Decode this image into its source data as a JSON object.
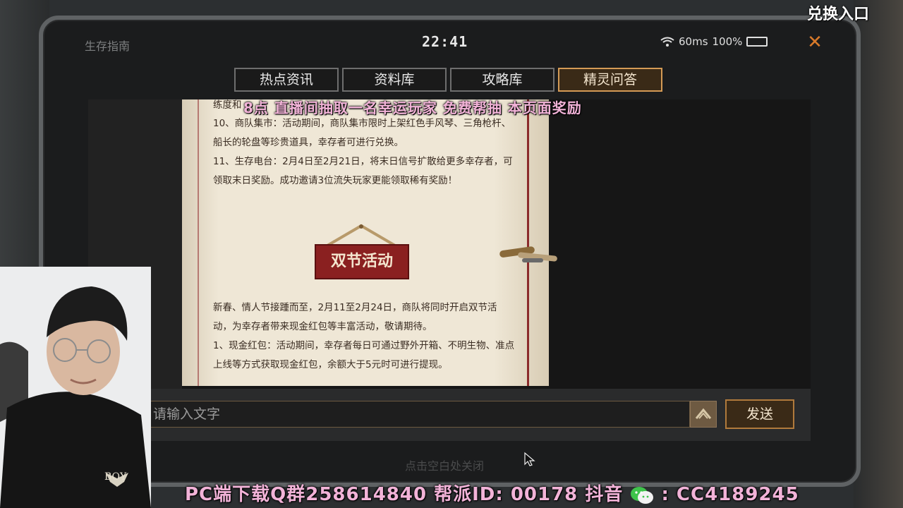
{
  "window": {
    "title": "生存指南",
    "time": "22:41",
    "ping": "60ms",
    "battery": "100%",
    "battery_level": 1.0
  },
  "tabs": [
    {
      "label": "热点资讯",
      "active": false
    },
    {
      "label": "资料库",
      "active": false
    },
    {
      "label": "攻略库",
      "active": false
    },
    {
      "label": "精灵问答",
      "active": true
    }
  ],
  "article": {
    "line_partial": "练度和",
    "item10": "10、商队集市：活动期间，商队集市限时上架红色手风琴、三角枪杆、船长的轮盘等珍贵道具，幸存者可进行兑换。",
    "item11": "11、生存电台：2月4日至2月21日，将末日信号扩散给更多幸存者，可领取末日奖励。成功邀请3位流失玩家更能领取稀有奖励！",
    "banner": "双节活动",
    "intro": "新春、情人节接踵而至，2月11至2月24日，商队将同时开启双节活动，为幸存者带来现金红包等丰富活动，敬请期待。",
    "item1": "1、现金红包：活动期间，幸存者每日可通过野外开箱、不明生物、准点上线等方式获取现金红包，余额大于5元时可进行提现。"
  },
  "input": {
    "placeholder": "请输入文字",
    "send_label": "发送"
  },
  "hint": "点击空白处关闭",
  "overlays": {
    "top": "8点 直播间抽取一名幸运玩家  免费帮抽 本页面奖励",
    "corner": "兑换入口",
    "bottom_left": "PC端下载Q群258614840  帮派ID: 00178  抖音",
    "bottom_right": ": CC4189245"
  },
  "webcam": {
    "logo_text": "BOY"
  },
  "colors": {
    "accent": "#d49a55",
    "close": "#d97a2a",
    "overlay_pink": "#f2b3d8",
    "banner_red": "#8a2020"
  },
  "icons": [
    "wifi-icon",
    "battery-icon",
    "close-icon",
    "chevron-up-icon",
    "cursor-icon",
    "wechat-icon"
  ]
}
